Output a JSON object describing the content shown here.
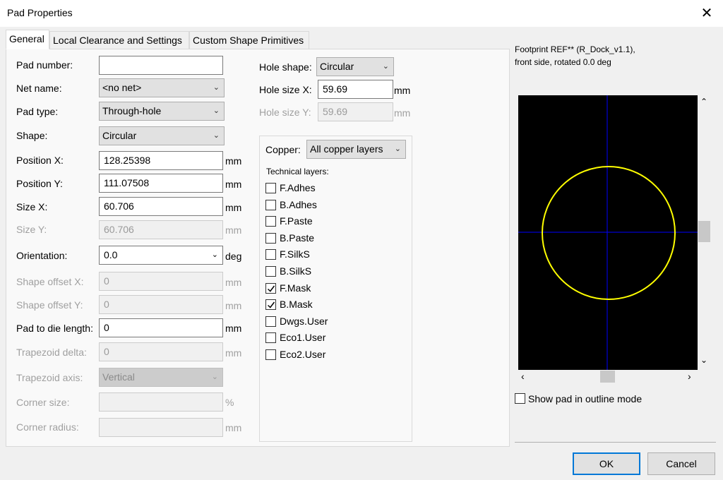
{
  "window": {
    "title": "Pad Properties",
    "close_symbol": "✕"
  },
  "tabs": [
    "General",
    "Local Clearance and Settings",
    "Custom Shape Primitives"
  ],
  "general": {
    "pad_number": {
      "label": "Pad number:",
      "value": ""
    },
    "net_name": {
      "label": "Net name:",
      "value": "<no net>"
    },
    "pad_type": {
      "label": "Pad type:",
      "value": "Through-hole"
    },
    "shape": {
      "label": "Shape:",
      "value": "Circular"
    },
    "position_x": {
      "label": "Position X:",
      "value": "128.25398",
      "unit": "mm"
    },
    "position_y": {
      "label": "Position Y:",
      "value": "111.07508",
      "unit": "mm"
    },
    "size_x": {
      "label": "Size X:",
      "value": "60.706",
      "unit": "mm"
    },
    "size_y": {
      "label": "Size Y:",
      "value": "60.706",
      "unit": "mm"
    },
    "orientation": {
      "label": "Orientation:",
      "value": "0.0",
      "unit": "deg"
    },
    "shape_offset_x": {
      "label": "Shape offset X:",
      "value": "0",
      "unit": "mm"
    },
    "shape_offset_y": {
      "label": "Shape offset Y:",
      "value": "0",
      "unit": "mm"
    },
    "pad_to_die": {
      "label": "Pad to die length:",
      "value": "0",
      "unit": "mm"
    },
    "trapezoid_delta": {
      "label": "Trapezoid delta:",
      "value": "0",
      "unit": "mm"
    },
    "trapezoid_axis": {
      "label": "Trapezoid axis:",
      "value": "Vertical"
    },
    "corner_size": {
      "label": "Corner size:",
      "value": "",
      "unit": "%"
    },
    "corner_radius": {
      "label": "Corner radius:",
      "value": "",
      "unit": "mm"
    }
  },
  "hole": {
    "shape": {
      "label": "Hole shape:",
      "value": "Circular"
    },
    "size_x": {
      "label": "Hole size X:",
      "value": "59.69",
      "unit": "mm"
    },
    "size_y": {
      "label": "Hole size Y:",
      "value": "59.69",
      "unit": "mm"
    }
  },
  "layers": {
    "copper_label": "Copper:",
    "copper_value": "All copper layers",
    "technical_label": "Technical layers:",
    "items": [
      {
        "name": "F.Adhes",
        "checked": false
      },
      {
        "name": "B.Adhes",
        "checked": false
      },
      {
        "name": "F.Paste",
        "checked": false
      },
      {
        "name": "B.Paste",
        "checked": false
      },
      {
        "name": "F.SilkS",
        "checked": false
      },
      {
        "name": "B.SilkS",
        "checked": false
      },
      {
        "name": "F.Mask",
        "checked": true
      },
      {
        "name": "B.Mask",
        "checked": true
      },
      {
        "name": "Dwgs.User",
        "checked": false
      },
      {
        "name": "Eco1.User",
        "checked": false
      },
      {
        "name": "Eco2.User",
        "checked": false
      }
    ]
  },
  "preview": {
    "caption_line1": "Footprint REF** (R_Dock_v1.1),",
    "caption_line2": "front side, rotated 0.0 deg",
    "background_color": "#000000",
    "pad_outline_color": "#ffff00",
    "crosshair_color": "#0000ff",
    "outline_mode_label": "Show pad in outline mode",
    "outline_mode_checked": false
  },
  "buttons": {
    "ok": "OK",
    "cancel": "Cancel"
  }
}
